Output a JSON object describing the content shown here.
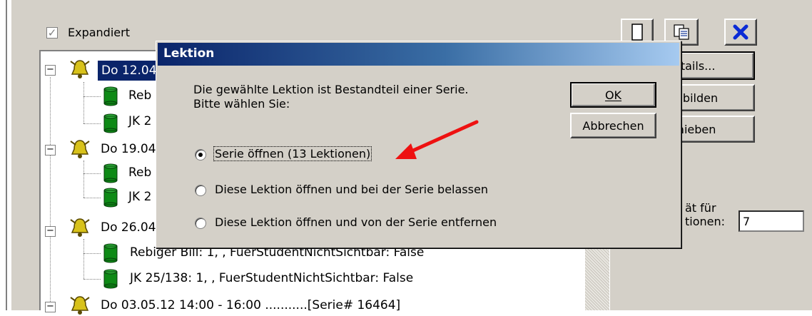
{
  "window": {
    "expand_checkbox": {
      "label": "Expandiert",
      "checked": true
    },
    "toolbar": {
      "new_icon": "blank-page-icon",
      "copy_icon": "copy-icon",
      "delete_icon": "delete-x-icon"
    },
    "side_buttons": [
      "etails...",
      "e bilden",
      "chieben"
    ],
    "capacity": {
      "label_line1": "ät für",
      "label_line2": "tionen:",
      "value": "7"
    }
  },
  "tree": {
    "nodes": [
      {
        "type": "lesson",
        "label": "Do 12.04",
        "selected": true
      },
      {
        "type": "participant",
        "label": "Reb"
      },
      {
        "type": "participant",
        "label": "JK 2"
      },
      {
        "type": "lesson",
        "label": "Do 19.04"
      },
      {
        "type": "participant",
        "label": "Reb"
      },
      {
        "type": "participant",
        "label": "JK 2"
      },
      {
        "type": "lesson",
        "label": "Do 26.04"
      },
      {
        "type": "participant",
        "label": "Rebiger Bill: 1, , FuerStudentNichtSichtbar: False"
      },
      {
        "type": "participant",
        "label": "JK 25/138: 1, , FuerStudentNichtSichtbar: False"
      },
      {
        "type": "lesson",
        "label": "Do 03.05.12 14:00 - 16:00 ...........[Serie# 16464]"
      }
    ]
  },
  "dialog": {
    "title": "Lektion",
    "message_line1": "Die gewählte Lektion ist Bestandteil einer Serie.",
    "message_line2": "Bitte wählen Sie:",
    "ok_label": "OK",
    "cancel_label": "Abbrechen",
    "options": [
      {
        "label": "Serie öffnen (13 Lektionen)",
        "selected": true
      },
      {
        "label": "Diese Lektion öffnen und bei der Serie belassen",
        "selected": false
      },
      {
        "label": "Diese Lektion öffnen und von der Serie entfernen",
        "selected": false
      }
    ]
  },
  "annotation": {
    "arrow_color": "#ee1111"
  },
  "colors": {
    "title_bar_start": "#0a246a",
    "title_bar_end": "#a6caf0",
    "selection": "#0a246a",
    "cylinder": "#0e8a16",
    "bell": "#d8c21a"
  }
}
